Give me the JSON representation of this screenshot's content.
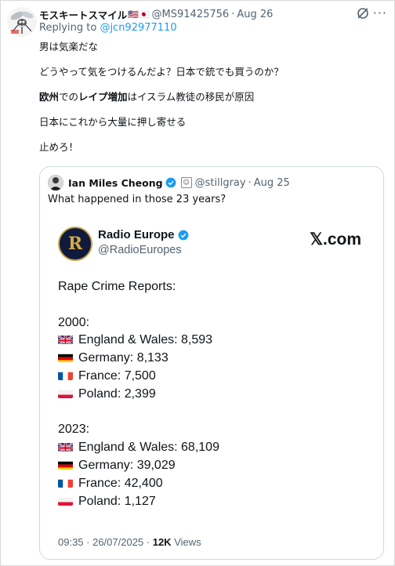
{
  "tweet": {
    "author_name": "モスキートスマイル",
    "author_flags": "🇺🇸🇯🇵",
    "handle": "@MS91425756",
    "sep": "·",
    "date": "Aug 26",
    "reply_prefix": "Replying to",
    "reply_to": "@jcn92977110",
    "lines": [
      "男は気楽だな",
      "どうやって気をつけるんだよ？日本で銃でも買うのか？",
      "日本にこれから大量に押し寄せる",
      "止めろ！"
    ],
    "line3": {
      "part1": "欧州",
      "part2": "での",
      "part3": "レイプ増加",
      "part4": "はイスラム教徒の移民が原因"
    }
  },
  "quote": {
    "author_name": "Ian Miles Cheong",
    "handle": "@stillgray",
    "sep": "·",
    "date": "Aug 25",
    "text": "What happened in those 23 years?"
  },
  "card": {
    "logo_letter": "R",
    "name": "Radio Europe",
    "handle": "@RadioEuropes",
    "brand": "𝕏.com",
    "heading": "Rape Crime Reports:",
    "year1": "2000:",
    "rows1": [
      {
        "flag": "uk",
        "text": "England & Wales: 8,593"
      },
      {
        "flag": "de",
        "text": "Germany: 8,133"
      },
      {
        "flag": "fr",
        "text": "France: 7,500"
      },
      {
        "flag": "pl",
        "text": "Poland: 2,399"
      }
    ],
    "year2": "2023:",
    "rows2": [
      {
        "flag": "uk",
        "text": "England & Wales: 68,109"
      },
      {
        "flag": "de",
        "text": "Germany: 39,029"
      },
      {
        "flag": "fr",
        "text": "France: 42,400"
      },
      {
        "flag": "pl",
        "text": "Poland: 1,127"
      }
    ],
    "timestamp": "09:35 · 26/07/2025 ·",
    "views_count": "12K",
    "views_label": "Views"
  },
  "colors": {
    "accent": "#1d9bf0",
    "secondary_text": "#536471",
    "border": "#cfd9de"
  }
}
